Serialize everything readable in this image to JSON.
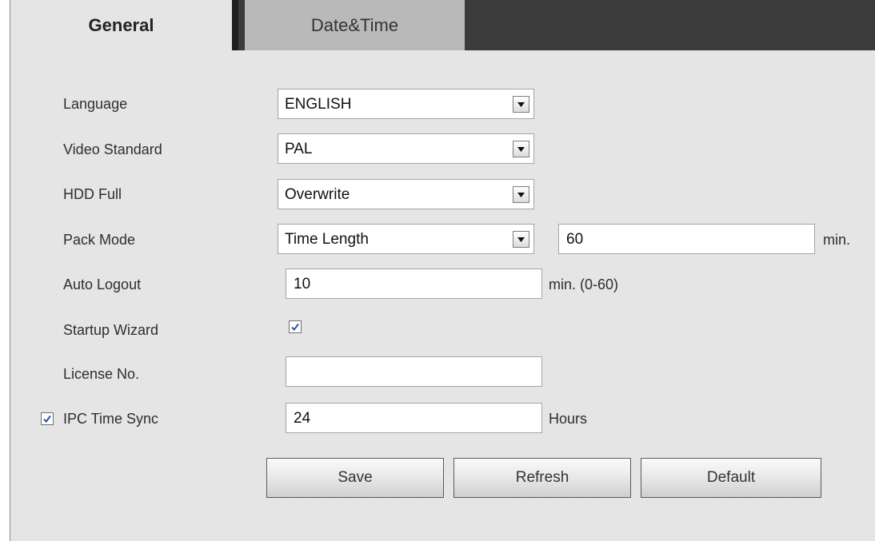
{
  "tabs": {
    "general": "General",
    "datetime": "Date&Time"
  },
  "fields": {
    "language": {
      "label": "Language",
      "value": "ENGLISH"
    },
    "video_standard": {
      "label": "Video Standard",
      "value": "PAL"
    },
    "hdd_full": {
      "label": "HDD Full",
      "value": "Overwrite"
    },
    "pack_mode": {
      "label": "Pack Mode",
      "value": "Time Length",
      "length_value": "60",
      "unit": "min."
    },
    "auto_logout": {
      "label": "Auto Logout",
      "value": "10",
      "unit": "min. (0-60)"
    },
    "startup_wizard": {
      "label": "Startup Wizard",
      "checked": true
    },
    "license_no": {
      "label": "License No.",
      "value": ""
    },
    "ipc_time_sync": {
      "label": "IPC Time Sync",
      "checked": true,
      "value": "24",
      "unit": "Hours"
    }
  },
  "buttons": {
    "save": "Save",
    "refresh": "Refresh",
    "default": "Default"
  },
  "icons": {
    "dropdown": "chevron-down-icon",
    "check": "checkmark-icon"
  },
  "colors": {
    "panel_bg": "#e5e5e5",
    "tabbar_bg": "#3b3b3b",
    "inactive_tab_bg": "#b9b9b9",
    "check_color": "#2a4fa8"
  }
}
